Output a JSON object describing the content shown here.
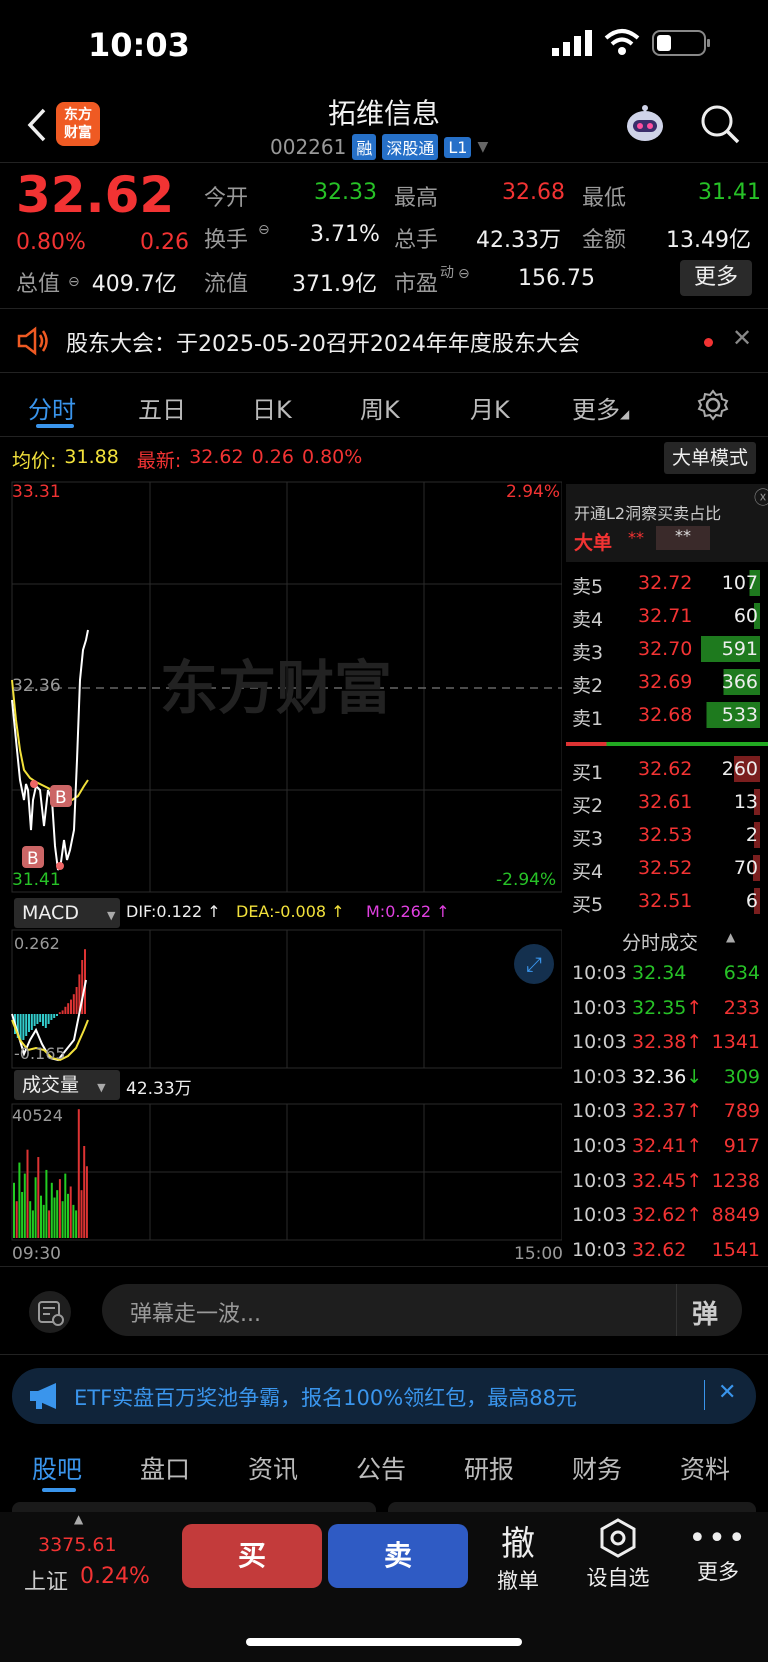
{
  "status_bar": {
    "time": "10:03"
  },
  "header": {
    "title": "拓维信息",
    "code": "002261",
    "tags": [
      "融",
      "深股通",
      "L1"
    ],
    "logo_text_1": "东方",
    "logo_text_2": "财富"
  },
  "quote": {
    "price": "32.62",
    "change_pct": "0.80%",
    "change": "0.26",
    "open_label": "今开",
    "open": "32.33",
    "high_label": "最高",
    "high": "32.68",
    "low_label": "最低",
    "low": "31.41",
    "turnover_label": "换手",
    "turnover": "3.71%",
    "volume_label": "总手",
    "volume": "42.33万",
    "amount_label": "金额",
    "amount": "13.49亿",
    "mktcap_label": "总值",
    "mktcap": "409.7亿",
    "float_label": "流值",
    "float_cap": "371.9亿",
    "pe_label": "市盈",
    "pe_sup": "动",
    "pe": "156.75",
    "more_label": "更多"
  },
  "notice": {
    "text": "股东大会：于2025-05-20召开2024年年度股东大会"
  },
  "chart_tabs": [
    "分时",
    "五日",
    "日K",
    "周K",
    "月K",
    "更多"
  ],
  "chart_info": {
    "avg_label": "均价:",
    "avg": "31.88",
    "latest_label": "最新:",
    "latest": "32.62",
    "latest_change": "0.26",
    "latest_pct": "0.80%",
    "big_order_mode": "大单模式"
  },
  "chart_labels": {
    "top_price": "33.31",
    "top_pct": "2.94%",
    "mid_price": "32.36",
    "bottom_price": "31.41",
    "bottom_pct": "-2.94%",
    "watermark": "东方财富",
    "time_start": "09:30",
    "time_end": "15:00"
  },
  "macd": {
    "label": "MACD",
    "dif": "DIF:0.122 ↑",
    "dea": "DEA:-0.008 ↑",
    "m": "M:0.262 ↑",
    "top": "0.262",
    "bottom": "-0.165"
  },
  "volume_panel": {
    "label": "成交量",
    "total": "42.33万",
    "max": "40524"
  },
  "colors": {
    "up": "#f23333",
    "down": "#27c227",
    "accent": "#2f8fe8",
    "avg_line": "#f2e13b"
  },
  "l2_promo": {
    "title": "开通L2洞察买卖占比",
    "big_label": "大单",
    "big_val1": "**",
    "big_val2": "**"
  },
  "order_book": {
    "asks": [
      {
        "label": "卖5",
        "price": "32.72",
        "vol": "107"
      },
      {
        "label": "卖4",
        "price": "32.71",
        "vol": "60"
      },
      {
        "label": "卖3",
        "price": "32.70",
        "vol": "591"
      },
      {
        "label": "卖2",
        "price": "32.69",
        "vol": "366"
      },
      {
        "label": "卖1",
        "price": "32.68",
        "vol": "533"
      }
    ],
    "bids": [
      {
        "label": "买1",
        "price": "32.62",
        "vol": "260"
      },
      {
        "label": "买2",
        "price": "32.61",
        "vol": "13"
      },
      {
        "label": "买3",
        "price": "32.53",
        "vol": "2"
      },
      {
        "label": "买4",
        "price": "32.52",
        "vol": "70"
      },
      {
        "label": "买5",
        "price": "32.51",
        "vol": "6"
      }
    ]
  },
  "trades": {
    "title": "分时成交",
    "rows": [
      {
        "time": "10:03",
        "price": "32.34",
        "dir": "",
        "vol": "634"
      },
      {
        "time": "10:03",
        "price": "32.35",
        "dir": "↑",
        "vol": "233"
      },
      {
        "time": "10:03",
        "price": "32.38",
        "dir": "↑",
        "vol": "1341"
      },
      {
        "time": "10:03",
        "price": "32.36",
        "dir": "↓",
        "vol": "309"
      },
      {
        "time": "10:03",
        "price": "32.37",
        "dir": "↑",
        "vol": "789"
      },
      {
        "time": "10:03",
        "price": "32.41",
        "dir": "↑",
        "vol": "917"
      },
      {
        "time": "10:03",
        "price": "32.45",
        "dir": "↑",
        "vol": "1238"
      },
      {
        "time": "10:03",
        "price": "32.62",
        "dir": "↑",
        "vol": "8849"
      },
      {
        "time": "10:03",
        "price": "32.62",
        "dir": "",
        "vol": "1541"
      }
    ]
  },
  "comment": {
    "placeholder": "弹幕走一波...",
    "danmu_btn": "弹"
  },
  "banner": {
    "text": "ETF实盘百万奖池争霸，报名100%领红包，最高88元"
  },
  "bottom_tabs": [
    "股吧",
    "盘口",
    "资讯",
    "公告",
    "研报",
    "财务",
    "资料"
  ],
  "bottom_bar": {
    "index_value": "3375.61",
    "index_name": "上证",
    "index_pct": "0.24%",
    "buy": "买",
    "sell": "卖",
    "cancel_icon_text": "撤",
    "cancel": "撤单",
    "watch": "设自选",
    "more": "更多"
  }
}
